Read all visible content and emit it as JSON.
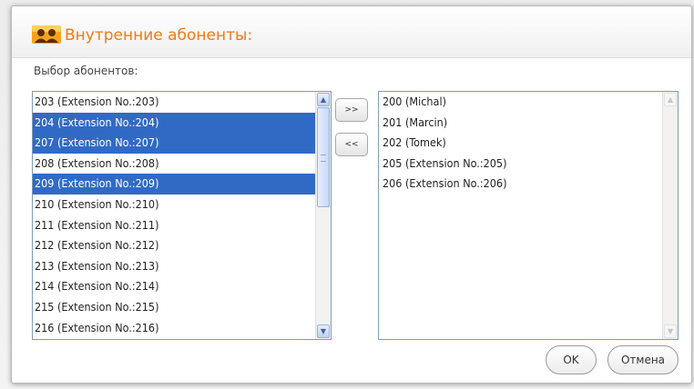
{
  "dialog": {
    "title": "Внутренние абоненты:",
    "section_label": "Выбор абонентов:"
  },
  "available": {
    "items": [
      {
        "label": "203 (Extension No.:203)",
        "selected": false
      },
      {
        "label": "204 (Extension No.:204)",
        "selected": true
      },
      {
        "label": "207 (Extension No.:207)",
        "selected": true
      },
      {
        "label": "208 (Extension No.:208)",
        "selected": false
      },
      {
        "label": "209 (Extension No.:209)",
        "selected": true
      },
      {
        "label": "210 (Extension No.:210)",
        "selected": false
      },
      {
        "label": "211 (Extension No.:211)",
        "selected": false
      },
      {
        "label": "212 (Extension No.:212)",
        "selected": false
      },
      {
        "label": "213 (Extension No.:213)",
        "selected": false
      },
      {
        "label": "214 (Extension No.:214)",
        "selected": false
      },
      {
        "label": "215 (Extension No.:215)",
        "selected": false
      },
      {
        "label": "216 (Extension No.:216)",
        "selected": false
      }
    ]
  },
  "chosen": {
    "items": [
      {
        "label": "200 (Michal)"
      },
      {
        "label": "201 (Marcin)"
      },
      {
        "label": "202 (Tomek)"
      },
      {
        "label": "205 (Extension No.:205)"
      },
      {
        "label": "206 (Extension No.:206)"
      }
    ]
  },
  "buttons": {
    "move_right": ">>",
    "move_left": "<<",
    "ok": "OK",
    "cancel": "Отмена"
  },
  "colors": {
    "title": "#f07a14",
    "selection": "#316ac5",
    "list_border": "#7f9db9"
  },
  "icons": {
    "title_icon": "users-group-icon",
    "scroll_up": "scroll-up-arrow-icon",
    "scroll_down": "scroll-down-arrow-icon"
  }
}
